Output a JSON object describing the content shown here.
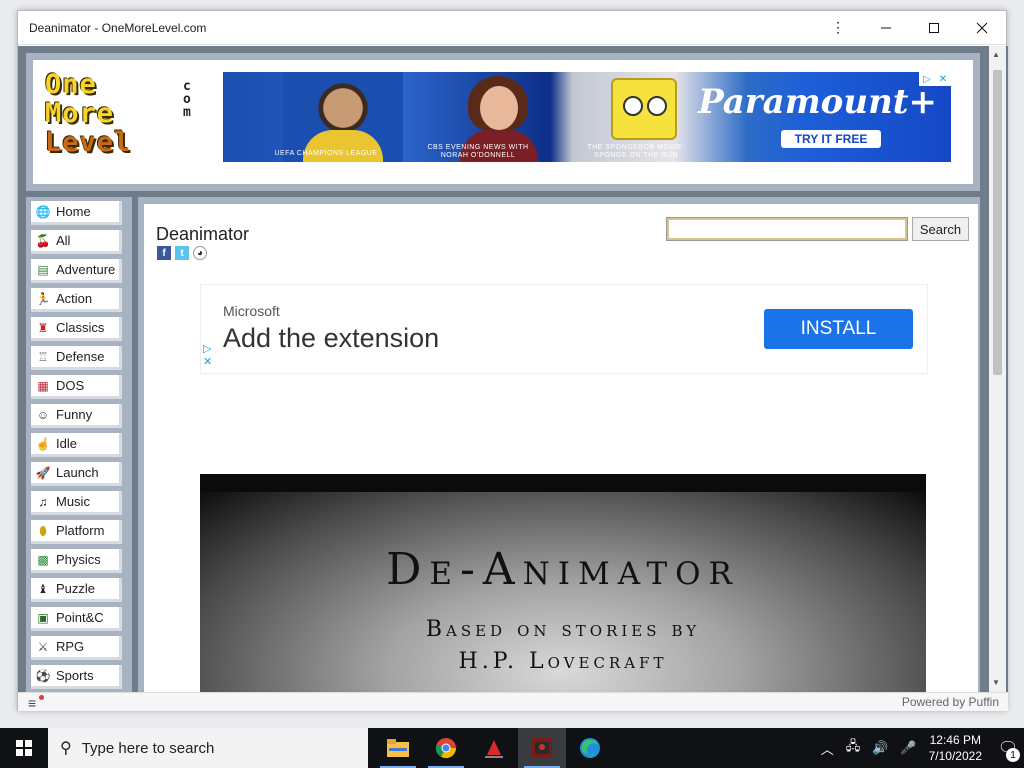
{
  "window": {
    "title": "Deanimator - OneMoreLevel.com",
    "status_text": "Powered by Puffin"
  },
  "site": {
    "logo_lines": [
      "One",
      "More",
      "Level"
    ],
    "logo_com": "c o m",
    "banner_ad": {
      "brand": "Paramount",
      "brand_plus": "+",
      "cta": "TRY IT FREE",
      "captions": [
        "UEFA CHAMPIONS LEAGUE",
        "CBS EVENING NEWS WITH NORAH O'DONNELL",
        "THE SPONGEBOB MOVIE: SPONGE ON THE RUN"
      ]
    },
    "nav": [
      {
        "label": "Home",
        "icon": "globe-icon"
      },
      {
        "label": "All",
        "icon": "cherries-icon"
      },
      {
        "label": "Adventure",
        "icon": "map-icon"
      },
      {
        "label": "Action",
        "icon": "runner-icon"
      },
      {
        "label": "Classics",
        "icon": "mario-icon"
      },
      {
        "label": "Defense",
        "icon": "tower-icon"
      },
      {
        "label": "DOS",
        "icon": "dos-icon"
      },
      {
        "label": "Funny",
        "icon": "smiley-icon"
      },
      {
        "label": "Idle",
        "icon": "hand-icon"
      },
      {
        "label": "Launch",
        "icon": "rocket-icon"
      },
      {
        "label": "Music",
        "icon": "music-note-icon"
      },
      {
        "label": "Platform",
        "icon": "coin-icon"
      },
      {
        "label": "Physics",
        "icon": "blocks-icon"
      },
      {
        "label": "Puzzle",
        "icon": "puzzle-icon"
      },
      {
        "label": "Point&C",
        "icon": "pointer-icon"
      },
      {
        "label": "RPG",
        "icon": "swords-icon"
      },
      {
        "label": "Sports",
        "icon": "soccer-ball-icon"
      }
    ],
    "game_title": "Deanimator",
    "search": {
      "value": "",
      "button": "Search"
    },
    "ad": {
      "advertiser": "Microsoft",
      "headline": "Add the extension",
      "cta": "INSTALL"
    },
    "game_screen": {
      "title": "De-Animator",
      "line1": "Based on stories by",
      "line2": "H.P. Lovecraft"
    }
  },
  "taskbar": {
    "search_placeholder": "Type here to search",
    "apps": [
      "file-explorer-icon",
      "chrome-icon",
      "app-icon",
      "puffin-icon",
      "edge-icon"
    ],
    "time": "12:46 PM",
    "date": "7/10/2022",
    "notification_count": "1"
  }
}
